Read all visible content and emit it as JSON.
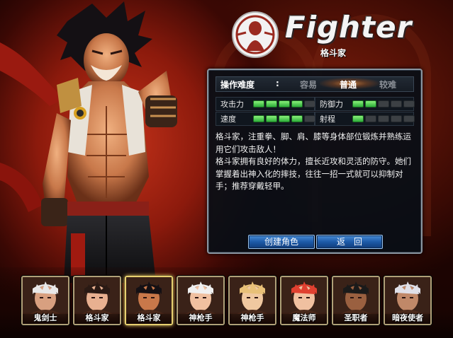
{
  "title": "Fighter",
  "subtitle": "格斗家",
  "panel": {
    "difficulty_label": "操作难度",
    "difficulty_colon": ":",
    "difficulty_options": [
      "容易",
      "普通",
      "较难"
    ],
    "difficulty_selected": "普通",
    "stats": [
      {
        "label": "攻击力",
        "value": 4,
        "max": 5
      },
      {
        "label": "防御力",
        "value": 2,
        "max": 5
      },
      {
        "label": "速度",
        "value": 4,
        "max": 5
      },
      {
        "label": "射程",
        "value": 1,
        "max": 5
      }
    ],
    "description": [
      "格斗家，注重拳、脚、肩、膝等身体部位锻炼并熟练运用它们攻击敌人！",
      "格斗家拥有良好的体力，擅长近攻和灵活的防守。她们掌握着出神入化的摔技，往往一招一式就可以抑制对手；推荐穿戴轻甲。"
    ],
    "create_button": "创建角色",
    "back_button": "返　回"
  },
  "characters": [
    {
      "name": "鬼剑士",
      "active": false
    },
    {
      "name": "格斗家",
      "active": false
    },
    {
      "name": "格斗家",
      "active": true
    },
    {
      "name": "神枪手",
      "active": false
    },
    {
      "name": "神枪手",
      "active": false
    },
    {
      "name": "魔法师",
      "active": false
    },
    {
      "name": "圣职者",
      "active": false
    },
    {
      "name": "暗夜使者",
      "active": false
    }
  ],
  "colors": {
    "accent_green": "#2cae3a",
    "button_blue": "#1d5aa8",
    "panel_border": "#8a95a0",
    "selected_glow": "#ff9a3c"
  }
}
